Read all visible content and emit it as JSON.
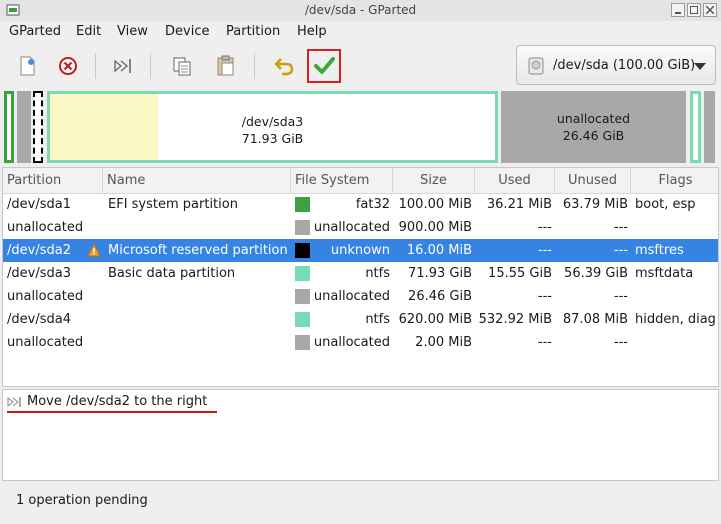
{
  "window": {
    "title": "/dev/sda - GParted"
  },
  "menu": [
    "GParted",
    "Edit",
    "View",
    "Device",
    "Partition",
    "Help"
  ],
  "toolbar": {
    "new": "new-partition-icon",
    "delete": "delete-partition-icon",
    "resize_move": "resize-move-icon",
    "copy": "copy-icon",
    "paste": "paste-icon",
    "undo": "undo-icon",
    "apply": "apply-icon"
  },
  "device": {
    "label": "/dev/sda (100.00 GiB)"
  },
  "map": {
    "sda3_name": "/dev/sda3",
    "sda3_size": "71.93 GiB",
    "unalloc_name": "unallocated",
    "unalloc_size": "26.46 GiB"
  },
  "table": {
    "headers": [
      "Partition",
      "Name",
      "File System",
      "Size",
      "Used",
      "Unused",
      "Flags"
    ],
    "rows": [
      {
        "partition": "/dev/sda1",
        "name": "EFI system partition",
        "fs": "fat32",
        "fs_color": "#3da142",
        "size": "100.00 MiB",
        "used": "36.21 MiB",
        "unused": "63.79 MiB",
        "flags": "boot, esp"
      },
      {
        "partition": "unallocated",
        "name": "",
        "fs": "unallocated",
        "fs_color": "#a8a8a8",
        "size": "900.00 MiB",
        "used": "---",
        "unused": "---",
        "flags": ""
      },
      {
        "partition": "/dev/sda2",
        "name": "Microsoft reserved partition",
        "fs": "unknown",
        "fs_color": "#000000",
        "size": "16.00 MiB",
        "used": "---",
        "unused": "---",
        "flags": "msftres",
        "selected": true,
        "warning": true
      },
      {
        "partition": "/dev/sda3",
        "name": "Basic data partition",
        "fs": "ntfs",
        "fs_color": "#79dbb2",
        "size": "71.93 GiB",
        "used": "15.55 GiB",
        "unused": "56.39 GiB",
        "flags": "msftdata"
      },
      {
        "partition": "unallocated",
        "name": "",
        "fs": "unallocated",
        "fs_color": "#a8a8a8",
        "size": "26.46 GiB",
        "used": "---",
        "unused": "---",
        "flags": ""
      },
      {
        "partition": "/dev/sda4",
        "name": "",
        "fs": "ntfs",
        "fs_color": "#79dbb2",
        "size": "620.00 MiB",
        "used": "532.92 MiB",
        "unused": "87.08 MiB",
        "flags": "hidden, diag"
      },
      {
        "partition": "unallocated",
        "name": "",
        "fs": "unallocated",
        "fs_color": "#a8a8a8",
        "size": "2.00 MiB",
        "used": "---",
        "unused": "---",
        "flags": ""
      }
    ]
  },
  "operations": [
    {
      "icon": "move-right-icon",
      "text": "Move /dev/sda2 to the right"
    }
  ],
  "status": {
    "text": "1 operation pending"
  }
}
